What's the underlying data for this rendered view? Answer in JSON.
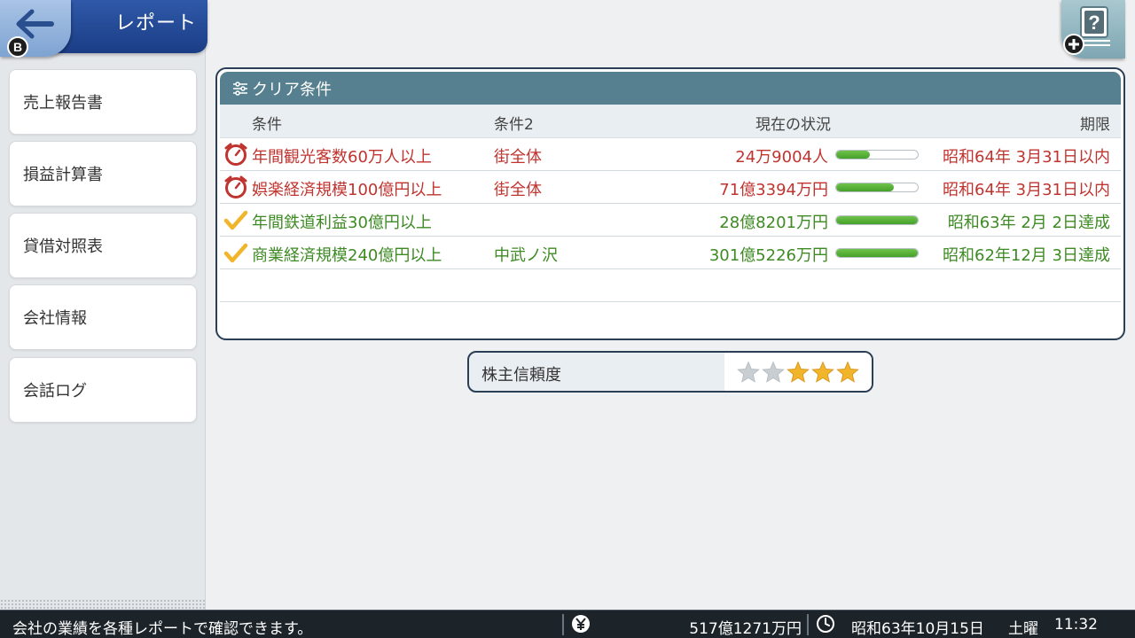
{
  "header": {
    "title": "レポート",
    "back_badge": "B"
  },
  "sidebar": {
    "items": [
      {
        "label": "売上報告書"
      },
      {
        "label": "損益計算書"
      },
      {
        "label": "貸借対照表"
      },
      {
        "label": "会社情報"
      },
      {
        "label": "会話ログ"
      }
    ]
  },
  "panel": {
    "title": "クリア条件",
    "columns": {
      "condition": "条件",
      "condition2": "条件2",
      "status": "現在の状況",
      "deadline": "期限"
    },
    "rows": [
      {
        "icon": "timer-icon",
        "condition": "年間観光客数60万人以上",
        "condition2": "街全体",
        "status": "24万9004人",
        "progress": 0.41,
        "deadline": "昭和64年 3月31日以内",
        "state": "in-progress"
      },
      {
        "icon": "timer-icon",
        "condition": "娯楽経済規模100億円以上",
        "condition2": "街全体",
        "status": "71億3394万円",
        "progress": 0.71,
        "deadline": "昭和64年 3月31日以内",
        "state": "in-progress"
      },
      {
        "icon": "checkmark-icon",
        "condition": "年間鉄道利益30億円以上",
        "condition2": "",
        "status": "28億8201万円",
        "progress": 1.0,
        "deadline": "昭和63年 2月 2日達成",
        "state": "achieved"
      },
      {
        "icon": "checkmark-icon",
        "condition": "商業経済規模240億円以上",
        "condition2": "中武ノ沢",
        "status": "301億5226万円",
        "progress": 1.0,
        "deadline": "昭和62年12月 3日達成",
        "state": "achieved"
      }
    ]
  },
  "trust": {
    "label": "株主信頼度",
    "stars_filled": 3,
    "stars_total": 5
  },
  "statusbar": {
    "message": "会社の業績を各種レポートで確認できます。",
    "money": "517億1271万円",
    "date": "昭和63年10月15日",
    "weekday": "土曜",
    "time": "11:32"
  },
  "colors": {
    "in_progress": "#c0342f",
    "achieved": "#3e8a23",
    "panel_header": "#56808f",
    "header_blue": "#1b3d86",
    "star_gold": "#f0b52a",
    "star_empty": "#c9ced2"
  }
}
